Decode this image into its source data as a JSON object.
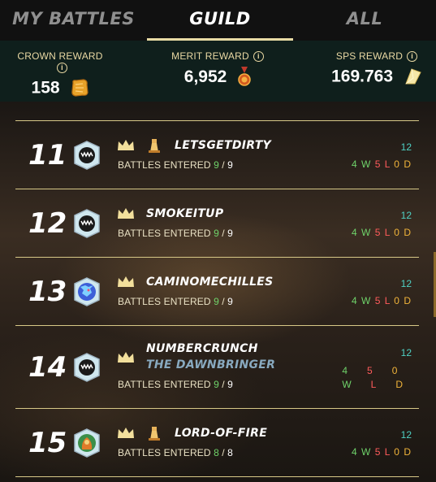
{
  "tabs": [
    {
      "label": "MY BATTLES",
      "active": false
    },
    {
      "label": "GUILD",
      "active": true
    },
    {
      "label": "ALL",
      "active": false
    }
  ],
  "rewards": {
    "crown": {
      "label": "CROWN REWARD",
      "value": "158",
      "icon": "crown-reward-icon"
    },
    "merit": {
      "label": "MERIT REWARD",
      "value": "6,952",
      "icon": "merit-medal-icon"
    },
    "sps": {
      "label": "SPS REWARD",
      "value": "169.763",
      "icon": "sps-token-icon"
    },
    "info_glyph": "i"
  },
  "battles_label": "BATTLES ENTERED",
  "players": [
    {
      "rank": "11",
      "name": "LETSGETDIRTY",
      "title": "",
      "entered": "9",
      "total": "9",
      "score": "12",
      "w": "4",
      "l": "5",
      "d": "0",
      "has_tower": true,
      "avatar": "monster-avatar-icon"
    },
    {
      "rank": "12",
      "name": "SMOKEITUP",
      "title": "",
      "entered": "9",
      "total": "9",
      "score": "12",
      "w": "4",
      "l": "5",
      "d": "0",
      "has_tower": false,
      "avatar": "monster-avatar-icon"
    },
    {
      "rank": "13",
      "name": "CAMINOMECHILLES",
      "title": "",
      "entered": "9",
      "total": "9",
      "score": "12",
      "w": "4",
      "l": "5",
      "d": "0",
      "has_tower": false,
      "avatar": "dragon-avatar-icon"
    },
    {
      "rank": "14",
      "name": "NUMBERCRUNCH",
      "title": "THE DAWNBRINGER",
      "entered": "9",
      "total": "9",
      "score": "12",
      "w": "4",
      "l": "5",
      "d": "0",
      "has_tower": false,
      "avatar": "monster-avatar-icon"
    },
    {
      "rank": "15",
      "name": "LORD-OF-FIRE",
      "title": "",
      "entered": "8",
      "total": "8",
      "score": "12",
      "w": "4",
      "l": "5",
      "d": "0",
      "has_tower": true,
      "avatar": "fire-lord-avatar-icon"
    }
  ],
  "wld_letters": {
    "w": "W",
    "l": "L",
    "d": "D"
  },
  "colors": {
    "accent": "#e8dba5",
    "win": "#6fd26a",
    "loss": "#ff5b5b",
    "draw": "#f0b43a",
    "score": "#4fd1c4",
    "title": "#88a9bf"
  }
}
